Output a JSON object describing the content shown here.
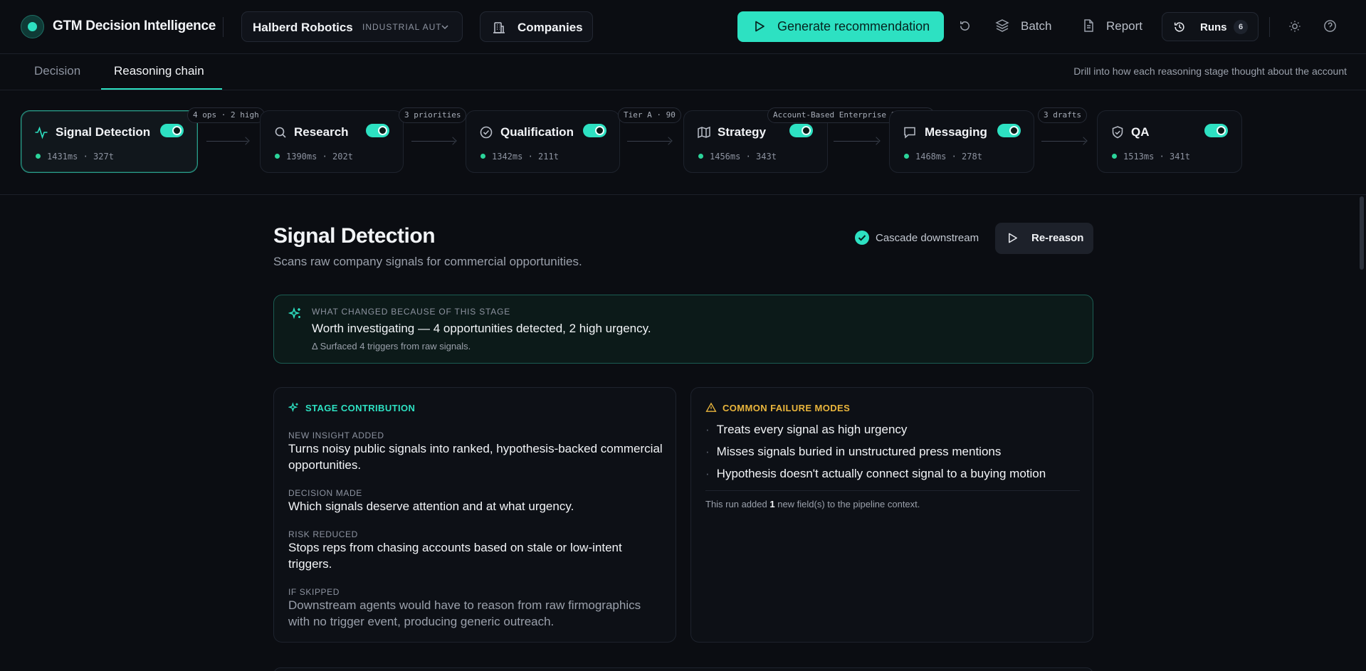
{
  "app": {
    "title": "GTM Decision Intelligence",
    "company_name": "Halberd Robotics",
    "company_industry": "INDUSTRIAL AUTOMATION",
    "companies_label": "Companies",
    "generate_label": "Generate recommendation",
    "batch_label": "Batch",
    "report_label": "Report",
    "runs_label": "Runs",
    "runs_count": "6",
    "accent": "#2de1c2"
  },
  "tabs": {
    "decision": "Decision",
    "reasoning": "Reasoning chain",
    "hint": "Drill into how each reasoning stage thought about the account"
  },
  "stages": [
    {
      "name": "Signal Detection",
      "meta": "1431ms · 327t",
      "icon": "activity-icon",
      "enabled": true,
      "active": true
    },
    {
      "name": "Research",
      "meta": "1390ms · 202t",
      "icon": "search-icon",
      "enabled": true
    },
    {
      "name": "Qualification",
      "meta": "1342ms · 211t",
      "icon": "check-circle-icon",
      "enabled": true
    },
    {
      "name": "Strategy",
      "meta": "1456ms · 343t",
      "icon": "map-icon",
      "enabled": true
    },
    {
      "name": "Messaging",
      "meta": "1468ms · 278t",
      "icon": "message-icon",
      "enabled": true
    },
    {
      "name": "QA",
      "meta": "1513ms · 341t",
      "icon": "shield-check-icon",
      "enabled": true
    }
  ],
  "connectors": [
    "4 ops · 2 high",
    "3 priorities",
    "Tier A · 90",
    "Account-Based Enterprise Outbound",
    "3 drafts"
  ],
  "detail": {
    "title": "Signal Detection",
    "subtitle": "Scans raw company signals for commercial opportunities.",
    "cascade_label": "Cascade downstream",
    "rereason_label": "Re-reason",
    "changed": {
      "kicker": "WHAT CHANGED BECAUSE OF THIS STAGE",
      "headline": "Worth investigating — 4 opportunities detected, 2 high urgency.",
      "delta": "Δ Surfaced 4 triggers from raw signals."
    },
    "contribution": {
      "heading": "STAGE CONTRIBUTION",
      "sections": [
        {
          "label": "NEW INSIGHT ADDED",
          "text": "Turns noisy public signals into ranked, hypothesis-backed commercial opportunities."
        },
        {
          "label": "DECISION MADE",
          "text": "Which signals deserve attention and at what urgency."
        },
        {
          "label": "RISK REDUCED",
          "text": "Stops reps from chasing accounts based on stale or low-intent triggers."
        },
        {
          "label": "IF SKIPPED",
          "text": "Downstream agents would have to reason from raw firmographics with no trigger event, producing generic outreach."
        }
      ]
    },
    "failures": {
      "heading": "COMMON FAILURE MODES",
      "items": [
        "Treats every signal as high urgency",
        "Misses signals buried in unstructured press mentions",
        "Hypothesis doesn't actually connect signal to a buying motion"
      ],
      "note_prefix": "This run added",
      "note_count": "1",
      "note_suffix": "new field(s) to the pipeline context."
    }
  }
}
